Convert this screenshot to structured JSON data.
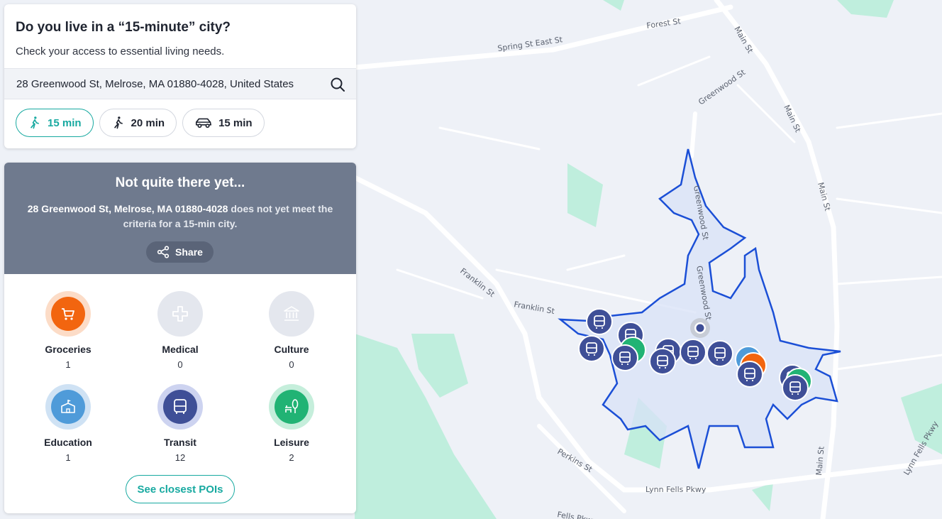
{
  "search": {
    "title": "Do you live in a “15-minute” city?",
    "subtitle": "Check your access to essential living needs.",
    "address": "28 Greenwood St, Melrose, MA 01880-4028, United States",
    "search_icon": "search-icon"
  },
  "modes": [
    {
      "icon": "walk-icon",
      "label": "15 min",
      "active": true
    },
    {
      "icon": "walk-icon",
      "label": "20 min",
      "active": false
    },
    {
      "icon": "car-icon",
      "label": "15 min",
      "active": false
    }
  ],
  "result": {
    "heading": "Not quite there yet...",
    "address_bold": "28 Greenwood St, Melrose, MA 01880-4028",
    "message_rest": " does not yet meet the criteria for a 15-min city.",
    "share_label": "Share"
  },
  "categories": [
    {
      "name": "Groceries",
      "count": "1",
      "icon": "cart-icon",
      "color": "#f2650f",
      "ring": "#fcdcc7"
    },
    {
      "name": "Medical",
      "count": "0",
      "icon": "medical-cross-icon",
      "color": "#e4e7ee",
      "ring": "#e4e7ee"
    },
    {
      "name": "Culture",
      "count": "0",
      "icon": "museum-icon",
      "color": "#e4e7ee",
      "ring": "#e4e7ee"
    },
    {
      "name": "Education",
      "count": "1",
      "icon": "school-icon",
      "color": "#4f9bd9",
      "ring": "#cfe2f4"
    },
    {
      "name": "Transit",
      "count": "12",
      "icon": "bus-icon",
      "color": "#3f4f97",
      "ring": "#cdd3f0"
    },
    {
      "name": "Leisure",
      "count": "2",
      "icon": "park-icon",
      "color": "#21b374",
      "ring": "#c5eedb"
    }
  ],
  "poi_button": "See closest POIs",
  "map": {
    "streets": [
      "Forest St",
      "Spring St East St",
      "Main St",
      "Greenwood St",
      "Main St",
      "Main St",
      "Greenwood St",
      "Greenwood St",
      "Franklin St",
      "Franklin St",
      "Perkins St",
      "Lynn Fells Pkwy",
      "Fells Pkwy",
      "Main St",
      "Lynn Fells Pkwy"
    ],
    "colors": {
      "isochrone": "#1b4fd6",
      "transit": "#3f4f97",
      "grocery": "#f2650f",
      "leisure": "#21b374",
      "education": "#4f9bd9",
      "park": "#bfeedd"
    }
  }
}
